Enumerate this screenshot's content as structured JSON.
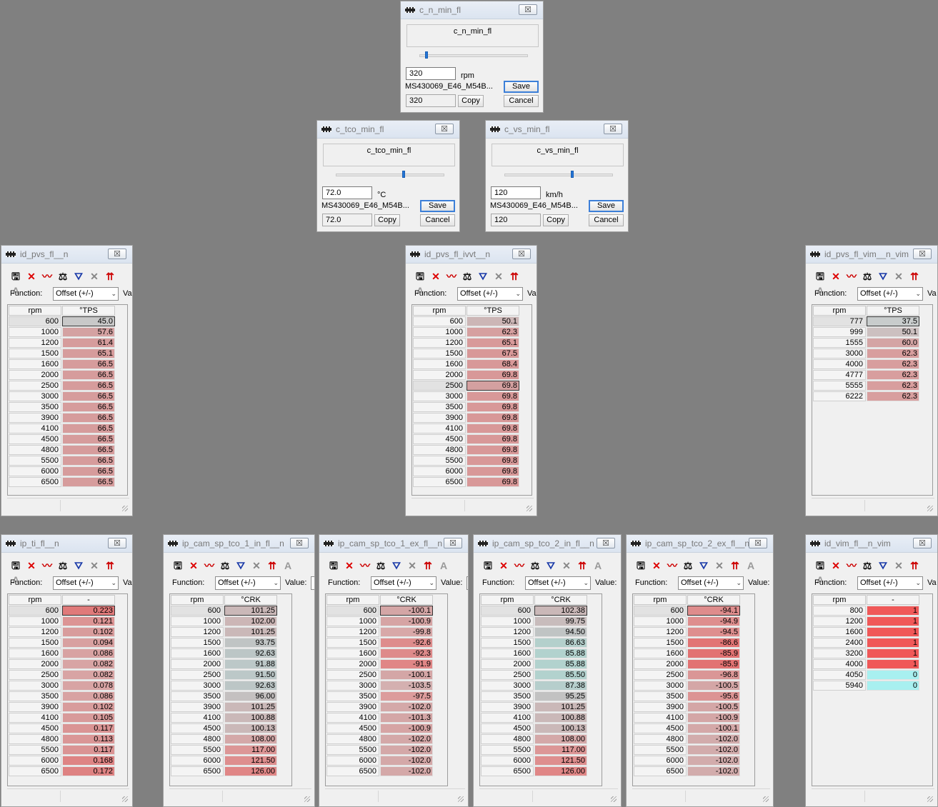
{
  "scalar_windows": [
    {
      "title": "c_n_min_fl",
      "label": "c_n_min_fl",
      "value": "320",
      "unit": "rpm",
      "source": "MS430069_E46_M54B...",
      "compare_value": "320",
      "buttons": {
        "save": "Save",
        "copy": "Copy",
        "cancel": "Cancel"
      },
      "slider_level": 0.05
    },
    {
      "title": "c_tco_min_fl",
      "label": "c_tco_min_fl",
      "value": "72.0",
      "unit": "°C",
      "source": "MS430069_E46_M54B...",
      "compare_value": "72.0",
      "buttons": {
        "save": "Save",
        "copy": "Copy",
        "cancel": "Cancel"
      },
      "slider_level": 0.62
    },
    {
      "title": "c_vs_min_fl",
      "label": "c_vs_min_fl",
      "value": "120",
      "unit": "km/h",
      "source": "MS430069_E46_M54B...",
      "compare_value": "120",
      "buttons": {
        "save": "Save",
        "copy": "Copy",
        "cancel": "Cancel"
      },
      "slider_level": 0.62
    }
  ],
  "common": {
    "function_label": "Function:",
    "function_value": "Offset (+/-)",
    "value_label": "Value:",
    "value_label_short": "Va"
  },
  "tables": [
    {
      "title": "id_pvs_fl__n",
      "col_axis": "rpm",
      "col_value": "°TPS",
      "selected": 0,
      "rows": [
        [
          "600",
          "45.0"
        ],
        [
          "1000",
          "57.6"
        ],
        [
          "1200",
          "61.4"
        ],
        [
          "1500",
          "65.1"
        ],
        [
          "1600",
          "66.5"
        ],
        [
          "2000",
          "66.5"
        ],
        [
          "2500",
          "66.5"
        ],
        [
          "3000",
          "66.5"
        ],
        [
          "3500",
          "66.5"
        ],
        [
          "3900",
          "66.5"
        ],
        [
          "4100",
          "66.5"
        ],
        [
          "4500",
          "66.5"
        ],
        [
          "4800",
          "66.5"
        ],
        [
          "5500",
          "66.5"
        ],
        [
          "6000",
          "66.5"
        ],
        [
          "6500",
          "66.5"
        ]
      ],
      "colors": [
        "#c8c8c8",
        "#d4a2a2",
        "#d69c9c",
        "#d69c9c",
        "#d69c9c",
        "#d69c9c",
        "#d69c9c",
        "#d69c9c",
        "#d69c9c",
        "#d69c9c",
        "#d69c9c",
        "#d69c9c",
        "#d69c9c",
        "#d69c9c",
        "#d69c9c",
        "#d69c9c"
      ]
    },
    {
      "title": "id_pvs_fl_ivvt__n",
      "col_axis": "rpm",
      "col_value": "°TPS",
      "selected": 6,
      "rows": [
        [
          "600",
          "50.1"
        ],
        [
          "1000",
          "62.3"
        ],
        [
          "1200",
          "65.1"
        ],
        [
          "1500",
          "67.5"
        ],
        [
          "1600",
          "68.4"
        ],
        [
          "2000",
          "69.8"
        ],
        [
          "2500",
          "69.8"
        ],
        [
          "3000",
          "69.8"
        ],
        [
          "3500",
          "69.8"
        ],
        [
          "3900",
          "69.8"
        ],
        [
          "4100",
          "69.8"
        ],
        [
          "4500",
          "69.8"
        ],
        [
          "4800",
          "69.8"
        ],
        [
          "5500",
          "69.8"
        ],
        [
          "6000",
          "69.8"
        ],
        [
          "6500",
          "69.8"
        ]
      ],
      "colors": [
        "#ccb6b6",
        "#d6a0a0",
        "#d89a9a",
        "#d89898",
        "#d89898",
        "#d89898",
        "#d4a0a0",
        "#d89898",
        "#d89898",
        "#d89898",
        "#d89898",
        "#d89898",
        "#d89898",
        "#d89898",
        "#d89898",
        "#d89898"
      ]
    },
    {
      "title": "id_pvs_fl_vim__n_vim",
      "col_axis": "rpm",
      "col_value": "°TPS",
      "selected": 0,
      "rows": [
        [
          "777",
          "37.5"
        ],
        [
          "999",
          "50.1"
        ],
        [
          "1555",
          "60.0"
        ],
        [
          "3000",
          "62.3"
        ],
        [
          "4000",
          "62.3"
        ],
        [
          "4777",
          "62.3"
        ],
        [
          "5555",
          "62.3"
        ],
        [
          "6222",
          "62.3"
        ]
      ],
      "colors": [
        "#c8cccc",
        "#ccc0c0",
        "#d4a4a4",
        "#d89e9e",
        "#d89e9e",
        "#d89e9e",
        "#d89e9e",
        "#d89e9e"
      ]
    },
    {
      "title": "ip_ti_fl__n",
      "col_axis": "rpm",
      "col_value": "-",
      "selected": 0,
      "rows": [
        [
          "600",
          "0.223"
        ],
        [
          "1000",
          "0.121"
        ],
        [
          "1200",
          "0.102"
        ],
        [
          "1500",
          "0.094"
        ],
        [
          "1600",
          "0.086"
        ],
        [
          "2000",
          "0.082"
        ],
        [
          "2500",
          "0.082"
        ],
        [
          "3000",
          "0.078"
        ],
        [
          "3500",
          "0.086"
        ],
        [
          "3900",
          "0.102"
        ],
        [
          "4100",
          "0.105"
        ],
        [
          "4500",
          "0.117"
        ],
        [
          "4800",
          "0.113"
        ],
        [
          "5500",
          "0.117"
        ],
        [
          "6000",
          "0.168"
        ],
        [
          "6500",
          "0.172"
        ]
      ],
      "colors": [
        "#e07a7a",
        "#dc9494",
        "#d89c9c",
        "#d8a0a0",
        "#d8a2a2",
        "#d8a4a4",
        "#d8a4a4",
        "#d8a4a4",
        "#d8a2a2",
        "#d89c9c",
        "#d89a9a",
        "#da9494",
        "#da9696",
        "#da9494",
        "#de8484",
        "#de8282"
      ]
    },
    {
      "title": "ip_cam_sp_tco_1_in_fl__n",
      "col_axis": "rpm",
      "col_value": "°CRK",
      "selected": 0,
      "rows": [
        [
          "600",
          "101.25"
        ],
        [
          "1000",
          "102.00"
        ],
        [
          "1200",
          "101.25"
        ],
        [
          "1500",
          "93.75"
        ],
        [
          "1600",
          "92.63"
        ],
        [
          "2000",
          "91.88"
        ],
        [
          "2500",
          "91.50"
        ],
        [
          "3000",
          "92.63"
        ],
        [
          "3500",
          "96.00"
        ],
        [
          "3900",
          "101.25"
        ],
        [
          "4100",
          "100.88"
        ],
        [
          "4500",
          "100.13"
        ],
        [
          "4800",
          "108.00"
        ],
        [
          "5500",
          "117.00"
        ],
        [
          "6000",
          "121.50"
        ],
        [
          "6500",
          "126.00"
        ]
      ],
      "colors": [
        "#cab8b8",
        "#ccb6b6",
        "#cab8b8",
        "#c0c4c4",
        "#bcc6c6",
        "#bcc8c8",
        "#bcc8c8",
        "#bcc6c6",
        "#c4c0c0",
        "#cab8b8",
        "#cab8b8",
        "#cab8b8",
        "#d4a8a8",
        "#dc9696",
        "#de8e8e",
        "#e08686"
      ]
    },
    {
      "title": "ip_cam_sp_tco_1_ex_fl__n",
      "col_axis": "rpm",
      "col_value": "°CRK",
      "selected": 0,
      "rows": [
        [
          "600",
          "-100.1"
        ],
        [
          "1000",
          "-100.9"
        ],
        [
          "1200",
          "-99.8"
        ],
        [
          "1500",
          "-92.6"
        ],
        [
          "1600",
          "-92.3"
        ],
        [
          "2000",
          "-91.9"
        ],
        [
          "2500",
          "-100.1"
        ],
        [
          "3000",
          "-103.5"
        ],
        [
          "3500",
          "-97.5"
        ],
        [
          "3900",
          "-102.0"
        ],
        [
          "4100",
          "-101.3"
        ],
        [
          "4500",
          "-100.9"
        ],
        [
          "4800",
          "-102.0"
        ],
        [
          "5500",
          "-102.0"
        ],
        [
          "6000",
          "-102.0"
        ],
        [
          "6500",
          "-102.0"
        ]
      ],
      "colors": [
        "#d4a6a6",
        "#d6a4a4",
        "#d8a8a8",
        "#de8c8c",
        "#de8a8a",
        "#e08686",
        "#d4a6a6",
        "#d4b0b0",
        "#dc9c9c",
        "#d4a8a8",
        "#d4a6a6",
        "#d6a4a4",
        "#d4a8a8",
        "#d4a8a8",
        "#d4a8a8",
        "#d4a8a8"
      ]
    },
    {
      "title": "ip_cam_sp_tco_2_in_fl__n",
      "col_axis": "rpm",
      "col_value": "°CRK",
      "selected": 0,
      "rows": [
        [
          "600",
          "102.38"
        ],
        [
          "1000",
          "99.75"
        ],
        [
          "1200",
          "94.50"
        ],
        [
          "1500",
          "86.63"
        ],
        [
          "1600",
          "85.88"
        ],
        [
          "2000",
          "85.88"
        ],
        [
          "2500",
          "85.50"
        ],
        [
          "3000",
          "87.38"
        ],
        [
          "3500",
          "95.25"
        ],
        [
          "3900",
          "101.25"
        ],
        [
          "4100",
          "100.88"
        ],
        [
          "4500",
          "100.13"
        ],
        [
          "4800",
          "108.00"
        ],
        [
          "5500",
          "117.00"
        ],
        [
          "6000",
          "121.50"
        ],
        [
          "6500",
          "126.00"
        ]
      ],
      "colors": [
        "#cab8b8",
        "#c8bcbc",
        "#c0c4c4",
        "#b4d0cc",
        "#b2d2ce",
        "#b2d2ce",
        "#b2d2ce",
        "#b6cecc",
        "#c2c2c2",
        "#cab8b8",
        "#cab8b8",
        "#cab8b8",
        "#d4a8a8",
        "#dc9696",
        "#de8e8e",
        "#e08686"
      ]
    },
    {
      "title": "ip_cam_sp_tco_2_ex_fl__n",
      "col_axis": "rpm",
      "col_value": "°CRK",
      "selected": 0,
      "rows": [
        [
          "600",
          "-94.1"
        ],
        [
          "1000",
          "-94.9"
        ],
        [
          "1200",
          "-94.5"
        ],
        [
          "1500",
          "-86.6"
        ],
        [
          "1600",
          "-85.9"
        ],
        [
          "2000",
          "-85.9"
        ],
        [
          "2500",
          "-96.8"
        ],
        [
          "3000",
          "-100.5"
        ],
        [
          "3500",
          "-95.6"
        ],
        [
          "3900",
          "-100.5"
        ],
        [
          "4100",
          "-100.9"
        ],
        [
          "4500",
          "-100.1"
        ],
        [
          "4800",
          "-102.0"
        ],
        [
          "5500",
          "-102.0"
        ],
        [
          "6000",
          "-102.0"
        ],
        [
          "6500",
          "-102.0"
        ]
      ],
      "colors": [
        "#de8c8c",
        "#de8e8e",
        "#de8e8e",
        "#e27474",
        "#e27272",
        "#e27272",
        "#da9696",
        "#d4a6a6",
        "#dc9494",
        "#d4a6a6",
        "#d4a6a6",
        "#d4a8a8",
        "#d2acac",
        "#d2acac",
        "#d2acac",
        "#d2acac"
      ]
    },
    {
      "title": "id_vim_fl__n_vim",
      "col_axis": "rpm",
      "col_value": "-",
      "selected": -1,
      "rows": [
        [
          "800",
          "1"
        ],
        [
          "1200",
          "1"
        ],
        [
          "1600",
          "1"
        ],
        [
          "2400",
          "1"
        ],
        [
          "3200",
          "1"
        ],
        [
          "4000",
          "1"
        ],
        [
          "4050",
          "0"
        ],
        [
          "5940",
          "0"
        ]
      ],
      "colors": [
        "#f05858",
        "#f05858",
        "#f05858",
        "#f05858",
        "#f05858",
        "#f05858",
        "#a8f0f0",
        "#a8f0f0"
      ]
    }
  ],
  "toolbar_icons": [
    "save-icon",
    "delete-icon",
    "graph-icon",
    "balance-icon",
    "peak-icon",
    "multiply-icon",
    "split-arrow-icon",
    "text-a-icon"
  ]
}
